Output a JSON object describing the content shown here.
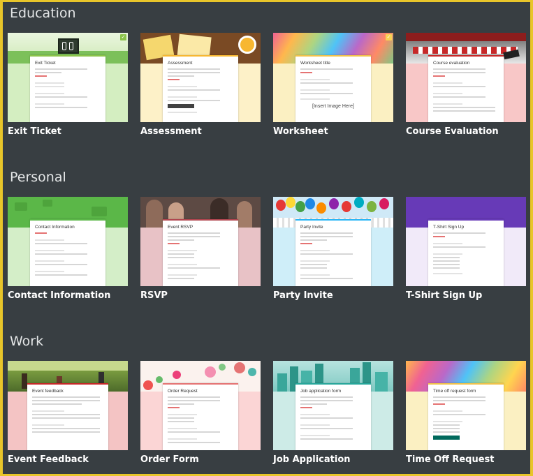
{
  "sections": [
    {
      "title": "Education",
      "cards": [
        {
          "label": "Exit Ticket",
          "form_title": "Exit Ticket"
        },
        {
          "label": "Assessment",
          "form_title": "Assessment"
        },
        {
          "label": "Worksheet",
          "form_title": "Worksheet title",
          "image_placeholder": "[Insert Image Here]"
        },
        {
          "label": "Course Evaluation",
          "form_title": "Course evaluation"
        }
      ]
    },
    {
      "title": "Personal",
      "cards": [
        {
          "label": "Contact Information",
          "form_title": "Contact Information"
        },
        {
          "label": "RSVP",
          "form_title": "Event RSVP"
        },
        {
          "label": "Party Invite",
          "form_title": "Party Invite"
        },
        {
          "label": "T-Shirt Sign Up",
          "form_title": "T-Shirt Sign Up"
        }
      ]
    },
    {
      "title": "Work",
      "cards": [
        {
          "label": "Event Feedback",
          "form_title": "Event feedback"
        },
        {
          "label": "Order Form",
          "form_title": "Order Request"
        },
        {
          "label": "Job Application",
          "form_title": "Job application form"
        },
        {
          "label": "Time Off Request",
          "form_title": "Time off request form"
        }
      ]
    }
  ],
  "colors": {
    "frame_border": "#e8c52a",
    "background": "#383e42",
    "label_text": "#ffffff",
    "section_text": "#e4e6e7"
  }
}
